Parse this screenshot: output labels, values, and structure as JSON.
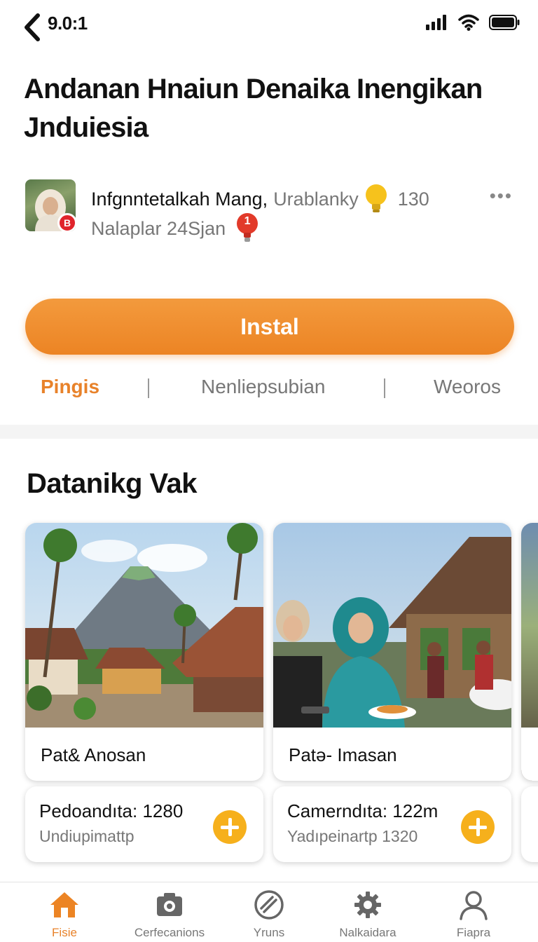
{
  "status_bar": {
    "time": "9.0:1"
  },
  "article": {
    "title": "Andanan Hnaiun Denaika Inengikan Jnduiesia",
    "author": {
      "name": "Infgnntetalkah Mang,",
      "role": "Urablanky",
      "likes": "130",
      "date": "Nalaplar 24Sjan",
      "avatar_badge": "B",
      "pin_label": "1"
    }
  },
  "install_button": {
    "label": "Instal"
  },
  "tabs": [
    {
      "label": "Pingis",
      "active": true
    },
    {
      "label": "Nenliepsubian",
      "active": false
    },
    {
      "label": "Weoros",
      "active": false
    }
  ],
  "section": {
    "title": "Datanikg Vak",
    "cards": [
      {
        "caption": "Pat& Anosan",
        "info_title": "Pedoandıta: 1280",
        "info_sub": "Undiupimattp"
      },
      {
        "caption": "Patə- Imasan",
        "info_title": "Camerndıta: 122m",
        "info_sub": "Yadıpeinartp 1320"
      }
    ]
  },
  "bottom_nav": [
    {
      "label": "Fisie",
      "icon": "home-icon",
      "active": true
    },
    {
      "label": "Cerfecanions",
      "icon": "camera-icon",
      "active": false
    },
    {
      "label": "Yruns",
      "icon": "slash-circle-icon",
      "active": false
    },
    {
      "label": "Nalkaidara",
      "icon": "gear-icon",
      "active": false
    },
    {
      "label": "Fiapra",
      "icon": "profile-icon",
      "active": false
    }
  ],
  "colors": {
    "accent": "#ec8424",
    "plus_button": "#f6b01c",
    "badge": "#e0242b",
    "muted_text": "#777777"
  }
}
